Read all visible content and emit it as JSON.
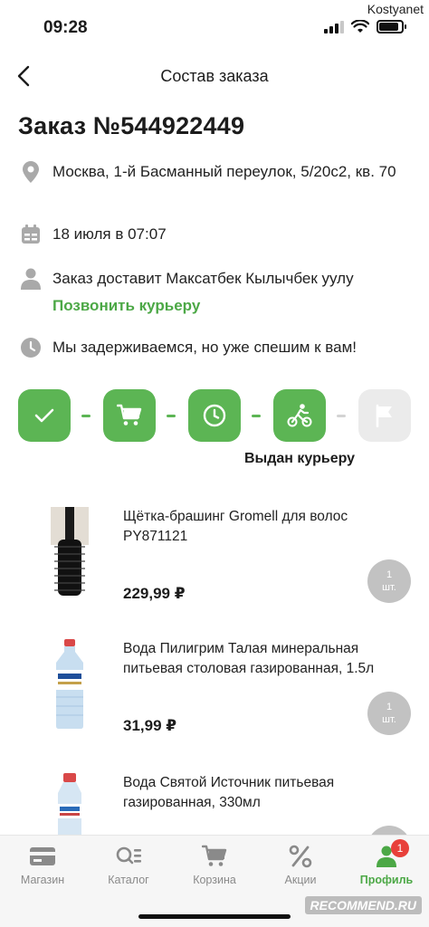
{
  "watermark_user": "Kostyanet",
  "status_bar": {
    "time": "09:28"
  },
  "nav": {
    "title": "Состав заказа"
  },
  "order": {
    "title": "Заказ №544922449",
    "address": "Москва, 1-й Басманный переулок, 5/20с2, кв. 70",
    "date": "18 июля в 07:07",
    "courier": "Заказ доставит Максатбек Кылычбек уулу",
    "call_courier": "Позвонить курьеру",
    "status_message": "Мы задерживаемся, но уже спешим к вам!"
  },
  "steps": {
    "caption": "Выдан курьеру",
    "items": [
      {
        "icon": "check-icon",
        "state": "done"
      },
      {
        "icon": "cart-icon",
        "state": "done"
      },
      {
        "icon": "clock-icon",
        "state": "done"
      },
      {
        "icon": "courier-bike-icon",
        "state": "current"
      },
      {
        "icon": "flag-icon",
        "state": "pending"
      }
    ]
  },
  "products": [
    {
      "name": "Щётка-брашинг Gromell для волос PY871121",
      "price": "229,99 ₽",
      "qty": "1",
      "unit": "шт."
    },
    {
      "name": "Вода Пилигрим Талая минеральная питьевая столовая газированная, 1.5л",
      "price": "31,99 ₽",
      "qty": "1",
      "unit": "шт."
    },
    {
      "name": "Вода Святой Источник питьевая газированная, 330мл",
      "price": "",
      "qty": "",
      "unit": ""
    }
  ],
  "tabs": [
    {
      "label": "Магазин",
      "icon": "card-icon"
    },
    {
      "label": "Каталог",
      "icon": "catalog-search-icon"
    },
    {
      "label": "Корзина",
      "icon": "cart-icon"
    },
    {
      "label": "Акции",
      "icon": "percent-icon"
    },
    {
      "label": "Профиль",
      "icon": "profile-icon",
      "badge": "1",
      "active": true
    }
  ],
  "colors": {
    "accent": "#5cb554",
    "accent_text": "#4ca846",
    "pending": "#ebebeb",
    "badge": "#e8403a",
    "qty_badge": "#c2c2c2"
  },
  "footer_mark": "RECOMMEND.RU"
}
